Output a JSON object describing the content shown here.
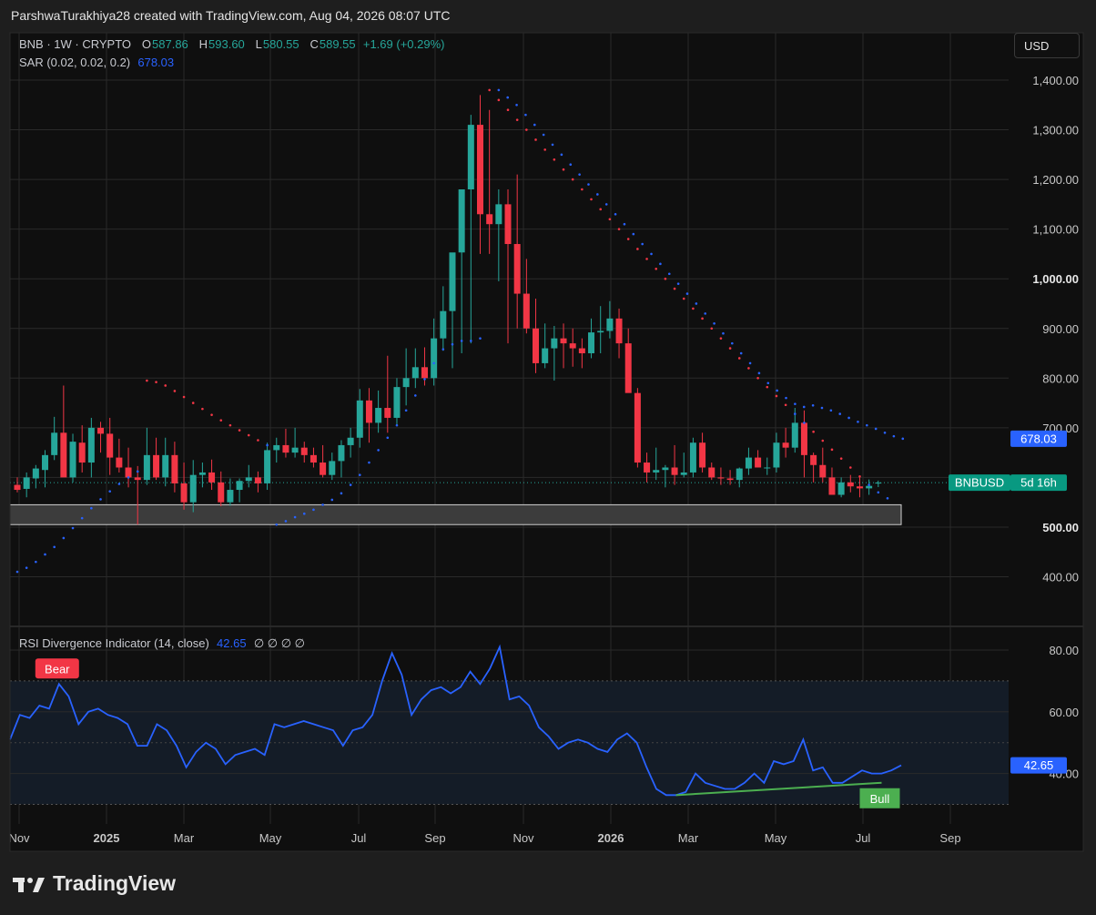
{
  "header": {
    "attribution": "ParshwaTurakhiya28 created with TradingView.com, Aug 04, 2026 08:07 UTC",
    "currency_button": "USD"
  },
  "legend": {
    "symbol": "BNB · 1W · CRYPTO",
    "o_label": "O",
    "o_value": "587.86",
    "h_label": "H",
    "h_value": "593.60",
    "l_label": "L",
    "l_value": "580.55",
    "c_label": "C",
    "c_value": "589.55",
    "change": "+1.69 (+0.29%)",
    "sar_label": "SAR (0.02, 0.02, 0.2)",
    "sar_value": "678.03"
  },
  "rsi_legend": {
    "label": "RSI Divergence Indicator (14, close)",
    "value": "42.65",
    "extras": "∅ ∅ ∅ ∅"
  },
  "brand": {
    "name": "TradingView"
  },
  "colors": {
    "up": "#26a69a",
    "down": "#f23645",
    "sar_up": "#2962ff",
    "sar_down": "#f23645",
    "rsi": "#2962ff",
    "bull": "#4caf50",
    "bear": "#f23645",
    "background": "#0f0f0f"
  },
  "chart_data": [
    {
      "type": "candlestick",
      "title": "BNB · 1W · CRYPTO",
      "ylim": [
        330,
        1440
      ],
      "y_ticks": [
        "1,400.00",
        "1,300.00",
        "1,200.00",
        "1,100.00",
        "1,000.00",
        "900.00",
        "800.00",
        "700.00",
        "500.00",
        "400.00"
      ],
      "x_ticks": [
        "Nov",
        "2025",
        "Mar",
        "May",
        "Jul",
        "Sep",
        "Nov",
        "2026",
        "Mar",
        "May",
        "Jul",
        "Sep"
      ],
      "price_labels": [
        {
          "text": "678.03",
          "value": 678.03,
          "color": "#2962ff"
        },
        {
          "symbol": "BNBUSD",
          "text": "5d 16h",
          "value": 589.55,
          "color": "#089981"
        }
      ],
      "support_zone": [
        505,
        545
      ],
      "ohlc": [
        [
          585,
          600,
          570,
          575
        ],
        [
          577,
          610,
          560,
          600
        ],
        [
          598,
          625,
          578,
          618
        ],
        [
          615,
          655,
          580,
          645
        ],
        [
          645,
          722,
          635,
          690
        ],
        [
          690,
          785,
          650,
          600
        ],
        [
          600,
          688,
          590,
          672
        ],
        [
          670,
          705,
          610,
          630
        ],
        [
          630,
          720,
          600,
          700
        ],
        [
          700,
          712,
          650,
          688
        ],
        [
          688,
          720,
          605,
          640
        ],
        [
          640,
          678,
          610,
          620
        ],
        [
          620,
          660,
          580,
          600
        ],
        [
          600,
          623,
          505,
          595
        ],
        [
          595,
          700,
          585,
          645
        ],
        [
          645,
          680,
          595,
          600
        ],
        [
          600,
          680,
          582,
          645
        ],
        [
          645,
          672,
          570,
          588
        ],
        [
          588,
          630,
          535,
          550
        ],
        [
          550,
          635,
          530,
          605
        ],
        [
          605,
          630,
          580,
          610
        ],
        [
          610,
          636,
          575,
          590
        ],
        [
          590,
          612,
          542,
          550
        ],
        [
          550,
          598,
          543,
          575
        ],
        [
          575,
          598,
          550,
          593
        ],
        [
          593,
          625,
          580,
          600
        ],
        [
          600,
          612,
          570,
          588
        ],
        [
          588,
          670,
          575,
          655
        ],
        [
          655,
          680,
          630,
          665
        ],
        [
          665,
          698,
          640,
          650
        ],
        [
          650,
          700,
          640,
          660
        ],
        [
          660,
          672,
          630,
          645
        ],
        [
          645,
          660,
          620,
          630
        ],
        [
          630,
          665,
          600,
          605
        ],
        [
          605,
          650,
          595,
          633
        ],
        [
          633,
          675,
          600,
          665
        ],
        [
          665,
          700,
          640,
          680
        ],
        [
          680,
          778,
          660,
          755
        ],
        [
          755,
          780,
          670,
          710
        ],
        [
          710,
          775,
          690,
          740
        ],
        [
          740,
          845,
          690,
          720
        ],
        [
          720,
          800,
          703,
          782
        ],
        [
          782,
          860,
          745,
          800
        ],
        [
          800,
          860,
          780,
          822
        ],
        [
          822,
          862,
          785,
          800
        ],
        [
          800,
          920,
          785,
          880
        ],
        [
          880,
          985,
          855,
          935
        ],
        [
          935,
          1050,
          820,
          1053
        ],
        [
          1053,
          1150,
          850,
          1180
        ],
        [
          1180,
          1330,
          870,
          1310
        ],
        [
          1310,
          1370,
          1050,
          1130
        ],
        [
          1130,
          1340,
          1050,
          1110
        ],
        [
          1110,
          1180,
          995,
          1150
        ],
        [
          1150,
          1180,
          870,
          1070
        ],
        [
          1070,
          1210,
          900,
          970
        ],
        [
          970,
          1040,
          890,
          900
        ],
        [
          900,
          960,
          810,
          830
        ],
        [
          830,
          910,
          820,
          860
        ],
        [
          860,
          905,
          795,
          880
        ],
        [
          880,
          910,
          820,
          870
        ],
        [
          870,
          900,
          823,
          860
        ],
        [
          860,
          880,
          820,
          850
        ],
        [
          850,
          920,
          840,
          892
        ],
        [
          892,
          945,
          850,
          895
        ],
        [
          895,
          955,
          880,
          920
        ],
        [
          920,
          940,
          840,
          870
        ],
        [
          870,
          900,
          790,
          770
        ],
        [
          770,
          780,
          620,
          630
        ],
        [
          630,
          650,
          590,
          610
        ],
        [
          610,
          660,
          595,
          615
        ],
        [
          615,
          625,
          580,
          620
        ],
        [
          620,
          665,
          585,
          605
        ],
        [
          605,
          650,
          600,
          610
        ],
        [
          610,
          680,
          600,
          670
        ],
        [
          670,
          690,
          610,
          620
        ],
        [
          620,
          630,
          595,
          600
        ],
        [
          600,
          620,
          585,
          598
        ],
        [
          598,
          615,
          585,
          595
        ],
        [
          595,
          620,
          580,
          618
        ],
        [
          618,
          660,
          605,
          640
        ],
        [
          640,
          655,
          620,
          620
        ],
        [
          620,
          640,
          605,
          620
        ],
        [
          620,
          690,
          610,
          670
        ],
        [
          670,
          700,
          640,
          660
        ],
        [
          660,
          740,
          650,
          710
        ],
        [
          710,
          735,
          600,
          645
        ],
        [
          645,
          650,
          590,
          625
        ],
        [
          625,
          660,
          590,
          600
        ],
        [
          600,
          620,
          565,
          565
        ],
        [
          565,
          600,
          560,
          590
        ],
        [
          590,
          605,
          570,
          582
        ],
        [
          582,
          600,
          560,
          578
        ],
        [
          578,
          596,
          565,
          583
        ],
        [
          587.86,
          593.6,
          580.55,
          589.55
        ]
      ],
      "sar_points": [
        {
          "x": 0.0,
          "y": 410
        },
        {
          "x": 1.0,
          "y": 418
        },
        {
          "x": 2.0,
          "y": 430
        },
        {
          "x": 3.0,
          "y": 445
        },
        {
          "x": 4.0,
          "y": 460
        },
        {
          "x": 5.0,
          "y": 478
        },
        {
          "x": 6.0,
          "y": 498
        },
        {
          "x": 7.0,
          "y": 518
        },
        {
          "x": 8.0,
          "y": 538
        },
        {
          "x": 9.0,
          "y": 556
        },
        {
          "x": 10.0,
          "y": 572
        },
        {
          "x": 11.0,
          "y": 587
        },
        {
          "x": 12.0,
          "y": 600
        },
        {
          "x": 13.0,
          "y": 612
        },
        {
          "x": 14.0,
          "y": 795
        },
        {
          "x": 15.0,
          "y": 792
        },
        {
          "x": 16.0,
          "y": 785
        },
        {
          "x": 17.0,
          "y": 774
        },
        {
          "x": 18.0,
          "y": 762
        },
        {
          "x": 19.0,
          "y": 750
        },
        {
          "x": 20.0,
          "y": 738
        },
        {
          "x": 21.0,
          "y": 726
        },
        {
          "x": 22.0,
          "y": 715
        },
        {
          "x": 23.0,
          "y": 705
        },
        {
          "x": 24.0,
          "y": 695
        },
        {
          "x": 25.0,
          "y": 685
        },
        {
          "x": 26.0,
          "y": 675
        },
        {
          "x": 27.0,
          "y": 665
        },
        {
          "x": 28.0,
          "y": 505
        },
        {
          "x": 29.0,
          "y": 512
        },
        {
          "x": 30.0,
          "y": 520
        },
        {
          "x": 31.0,
          "y": 527
        },
        {
          "x": 32.0,
          "y": 535
        },
        {
          "x": 33.0,
          "y": 545
        },
        {
          "x": 34.0,
          "y": 555
        },
        {
          "x": 35.0,
          "y": 568
        },
        {
          "x": 36.0,
          "y": 585
        },
        {
          "x": 37.0,
          "y": 605
        },
        {
          "x": 38.0,
          "y": 630
        },
        {
          "x": 39.0,
          "y": 655
        },
        {
          "x": 40.0,
          "y": 680
        },
        {
          "x": 41.0,
          "y": 705
        },
        {
          "x": 42.0,
          "y": 735
        },
        {
          "x": 43.0,
          "y": 765
        },
        {
          "x": 44.0,
          "y": 798
        },
        {
          "x": 45.0,
          "y": 830
        },
        {
          "x": 46.0,
          "y": 858
        },
        {
          "x": 47.0,
          "y": 868
        },
        {
          "x": 48.0,
          "y": 875
        },
        {
          "x": 49.0,
          "y": 875
        },
        {
          "x": 50.0,
          "y": 880
        },
        {
          "x": 51.0,
          "y": 1380
        },
        {
          "x": 52.0,
          "y": 1360
        },
        {
          "x": 53.0,
          "y": 1340
        },
        {
          "x": 54.0,
          "y": 1320
        },
        {
          "x": 55.0,
          "y": 1300
        },
        {
          "x": 56.0,
          "y": 1280
        },
        {
          "x": 57.0,
          "y": 1260
        },
        {
          "x": 58.0,
          "y": 1240
        },
        {
          "x": 59.0,
          "y": 1220
        },
        {
          "x": 60.0,
          "y": 1200
        },
        {
          "x": 61.0,
          "y": 1180
        },
        {
          "x": 62.0,
          "y": 1160
        },
        {
          "x": 63.0,
          "y": 1140
        },
        {
          "x": 64.0,
          "y": 1120
        },
        {
          "x": 65.0,
          "y": 1100
        },
        {
          "x": 66.0,
          "y": 1080
        },
        {
          "x": 67.0,
          "y": 1060
        },
        {
          "x": 68.0,
          "y": 1040
        },
        {
          "x": 69.0,
          "y": 1020
        },
        {
          "x": 70.0,
          "y": 1000
        },
        {
          "x": 71.0,
          "y": 980
        },
        {
          "x": 72.0,
          "y": 960
        },
        {
          "x": 73.0,
          "y": 940
        },
        {
          "x": 74.0,
          "y": 920
        },
        {
          "x": 75.0,
          "y": 900
        },
        {
          "x": 76.0,
          "y": 880
        },
        {
          "x": 77.0,
          "y": 860
        },
        {
          "x": 78.0,
          "y": 840
        },
        {
          "x": 79.0,
          "y": 820
        },
        {
          "x": 80.0,
          "y": 800
        },
        {
          "x": 81.0,
          "y": 782
        },
        {
          "x": 82.0,
          "y": 764
        },
        {
          "x": 83.0,
          "y": 746
        },
        {
          "x": 84.0,
          "y": 728
        },
        {
          "x": 85.0,
          "y": 710
        },
        {
          "x": 86.0,
          "y": 692
        },
        {
          "x": 87.0,
          "y": 674
        },
        {
          "x": 88.0,
          "y": 656
        },
        {
          "x": 89.0,
          "y": 638
        },
        {
          "x": 90.0,
          "y": 620
        },
        {
          "x": 91.0,
          "y": 602
        },
        {
          "x": 92.0,
          "y": 585
        },
        {
          "x": 93.0,
          "y": 570
        },
        {
          "x": 94.0,
          "y": 558
        }
      ]
    },
    {
      "type": "line",
      "title": "RSI Divergence Indicator (14, close)",
      "ylim": [
        28,
        82
      ],
      "y_ticks": [
        "80.00",
        "60.00",
        "40.00"
      ],
      "band": [
        30,
        70
      ],
      "midline": 50,
      "value_label": "42.65",
      "values": [
        51,
        59,
        58,
        62,
        61,
        69,
        65,
        56,
        60,
        61,
        59,
        58,
        56,
        49,
        49,
        56,
        54,
        49,
        42,
        47,
        50,
        48,
        43,
        46,
        47,
        48,
        46,
        56,
        55,
        56,
        57,
        56,
        55,
        54,
        49,
        54,
        55,
        59,
        70,
        79,
        72,
        59,
        64,
        67,
        68,
        66,
        68,
        73,
        69,
        74,
        81,
        64,
        65,
        62,
        55,
        52,
        48,
        50,
        51,
        50,
        48,
        47,
        51,
        53,
        50,
        42,
        35,
        33,
        33,
        34,
        40,
        37,
        36,
        35,
        35,
        37,
        40,
        37,
        44,
        43,
        44,
        51,
        41,
        42,
        37,
        37,
        39,
        41,
        40,
        40,
        41,
        42.65
      ],
      "bull_divergence": {
        "from_index": 68,
        "to_index": 89,
        "from_value": 33,
        "to_value": 37,
        "label": "Bull"
      },
      "bear_label": {
        "index": 5,
        "value": 69,
        "label": "Bear"
      }
    }
  ]
}
